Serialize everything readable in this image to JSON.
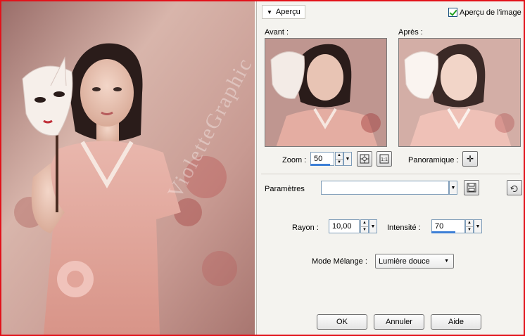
{
  "preview_header": {
    "toggle_label": "Aperçu",
    "image_preview_label": "Aperçu de l'image",
    "image_preview_checked": true
  },
  "before_label": "Avant :",
  "after_label": "Après :",
  "zoom": {
    "label": "Zoom :",
    "value": "50"
  },
  "pan_label": "Panoramique :",
  "presets": {
    "label": "Paramètres",
    "value": ""
  },
  "radius": {
    "label": "Rayon :",
    "value": "10,00"
  },
  "intensity": {
    "label": "Intensité :",
    "value": "70",
    "level_percent": 70
  },
  "blend_mode": {
    "label": "Mode Mélange :",
    "value": "Lumière douce"
  },
  "buttons": {
    "ok": "OK",
    "cancel": "Annuler",
    "help": "Aide"
  },
  "watermark_text": "VioletteGraphic",
  "colors": {
    "frame_border": "#e2121a",
    "panel_bg": "#f4f3ef",
    "accent_blue": "#3d7fd6"
  }
}
